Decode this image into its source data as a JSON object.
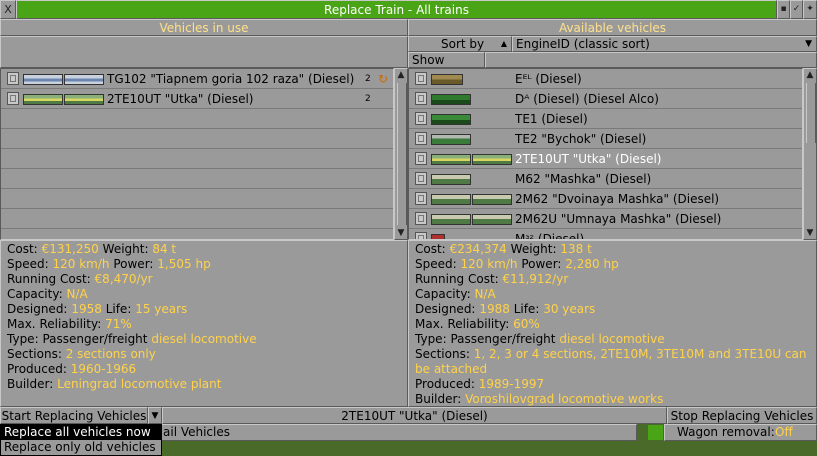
{
  "window": {
    "title": "Replace Train - All trains",
    "close_glyph": "X",
    "sticky_glyph": "✓"
  },
  "left_panel": {
    "header": "Vehicles in use",
    "rows": [
      {
        "name": "TG102 \"Tiapnem goria 102 raza\" (Diesel)",
        "count": "2",
        "has_autoreplace_icon": true
      },
      {
        "name": "2TE10UT \"Utka\" (Diesel)",
        "count": "2",
        "has_autoreplace_icon": false
      }
    ],
    "info": {
      "cost_label": "Cost:",
      "cost": "€131,250",
      "weight_label": "Weight:",
      "weight": "84 t",
      "speed_label": "Speed:",
      "speed": "120 km/h",
      "power_label": "Power:",
      "power": "1,505 hp",
      "running_label": "Running Cost:",
      "running": "€8,470/yr",
      "capacity_label": "Capacity:",
      "capacity": "N/A",
      "designed_label": "Designed:",
      "designed": "1958",
      "life_label": "Life:",
      "life": "15 years",
      "reliability_label": "Max. Reliability:",
      "reliability": "71%",
      "type_label": "Type:",
      "type_plain": "Passenger/freight",
      "type_value": "diesel locomotive",
      "sections_label": "Sections:",
      "sections": "2 sections only",
      "produced_label": "Produced:",
      "produced": "1960-1966",
      "builder_label": "Builder:",
      "builder": "Leningrad locomotive plant"
    }
  },
  "right_panel": {
    "header": "Available vehicles",
    "sort_label": "Sort by",
    "sort_value": "EngineID (classic sort)",
    "show_hidden": "Show hidden",
    "rows": [
      {
        "name": "Eᴱᴸ (Diesel)",
        "selected": false
      },
      {
        "name": "Dᴬ (Diesel) (Diesel Alco)",
        "selected": false
      },
      {
        "name": "TE1 (Diesel)",
        "selected": false
      },
      {
        "name": "TE2 \"Bychok\" (Diesel)",
        "selected": false
      },
      {
        "name": "2TE10UT \"Utka\" (Diesel)",
        "selected": true
      },
      {
        "name": "M62 \"Mashka\" (Diesel)",
        "selected": false
      },
      {
        "name": "2M62 \"Dvoinaya Mashka\" (Diesel)",
        "selected": false
      },
      {
        "name": "2M62U \"Umnaya Mashka\" (Diesel)",
        "selected": false
      },
      {
        "name": "Mᶟᶻ (Diesel)",
        "selected": false
      }
    ],
    "info": {
      "cost_label": "Cost:",
      "cost": "€234,374",
      "weight_label": "Weight:",
      "weight": "138 t",
      "speed_label": "Speed:",
      "speed": "120 km/h",
      "power_label": "Power:",
      "power": "2,280 hp",
      "running_label": "Running Cost:",
      "running": "€11,912/yr",
      "capacity_label": "Capacity:",
      "capacity": "N/A",
      "designed_label": "Designed:",
      "designed": "1988",
      "life_label": "Life:",
      "life": "30 years",
      "reliability_label": "Max. Reliability:",
      "reliability": "60%",
      "type_label": "Type:",
      "type_plain": "Passenger/freight",
      "type_value": "diesel locomotive",
      "sections_label": "Sections:",
      "sections_line1": "1, 2, 3 or 4 sections, 2TE10M, 3TE10M and 3TE10U can",
      "sections_line2": "be attached",
      "produced_label": "Produced:",
      "produced": "1989-1997",
      "builder_label": "Builder:",
      "builder": "Voroshilovgrad locomotive works"
    }
  },
  "bottom": {
    "start_button": "Start Replacing Vehicles",
    "replacement_label": "2TE10UT \"Utka\" (Diesel)",
    "stop_button": "Stop Replacing Vehicles",
    "rail_label": "ail Vehicles",
    "wagon_removal_label": "Wagon removal:",
    "wagon_removal_value": "Off"
  },
  "dropdown": {
    "items": [
      "Replace all vehicles now",
      "Replace only old vehicles"
    ],
    "highlighted": 0
  },
  "colors": {
    "title_bar": "#49a515",
    "panel": "#9a9a9a",
    "yellow_value": "#ffd24a",
    "header_text": "#ffe08a"
  }
}
